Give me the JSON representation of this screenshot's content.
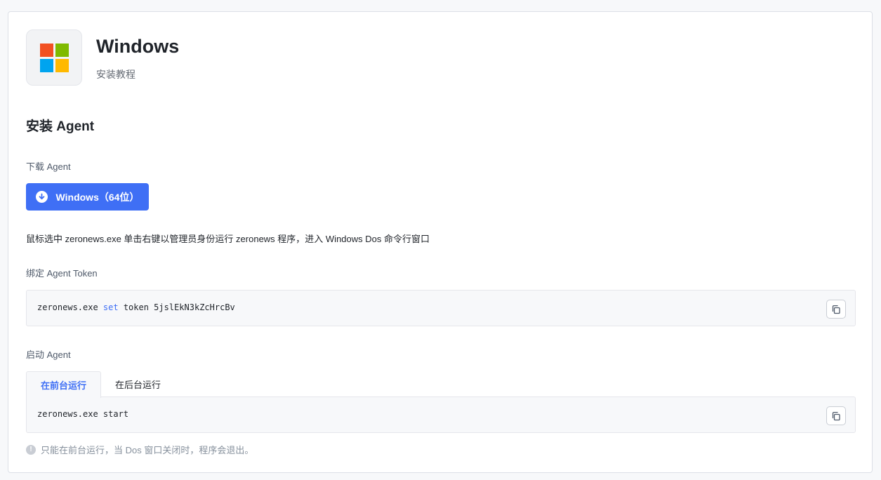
{
  "header": {
    "title": "Windows",
    "subtitle": "安装教程",
    "logo_colors": [
      "#f25022",
      "#7fba00",
      "#00a4ef",
      "#ffb900"
    ]
  },
  "install": {
    "section_title": "安装 Agent",
    "download_label": "下载 Agent",
    "download_button": "Windows（64位）",
    "description": "鼠标选中 zeronews.exe 单击右键以管理员身份运行 zeronews 程序，进入 Windows Dos 命令行窗口"
  },
  "bind": {
    "label": "绑定 Agent Token",
    "command_prefix": "zeronews.exe ",
    "command_keyword": "set",
    "command_suffix": " token 5jslEkN3kZcHrcBv",
    "copy_icon": "copy-icon"
  },
  "start": {
    "label": "启动 Agent",
    "tabs": [
      {
        "label": "在前台运行",
        "active": true
      },
      {
        "label": "在后台运行",
        "active": false
      }
    ],
    "command": "zeronews.exe start",
    "hint": "只能在前台运行，当 Dos 窗口关闭时，程序会退出。"
  },
  "colors": {
    "accent": "#3f6ff5",
    "text": "#1f2329",
    "muted": "#86909c"
  }
}
